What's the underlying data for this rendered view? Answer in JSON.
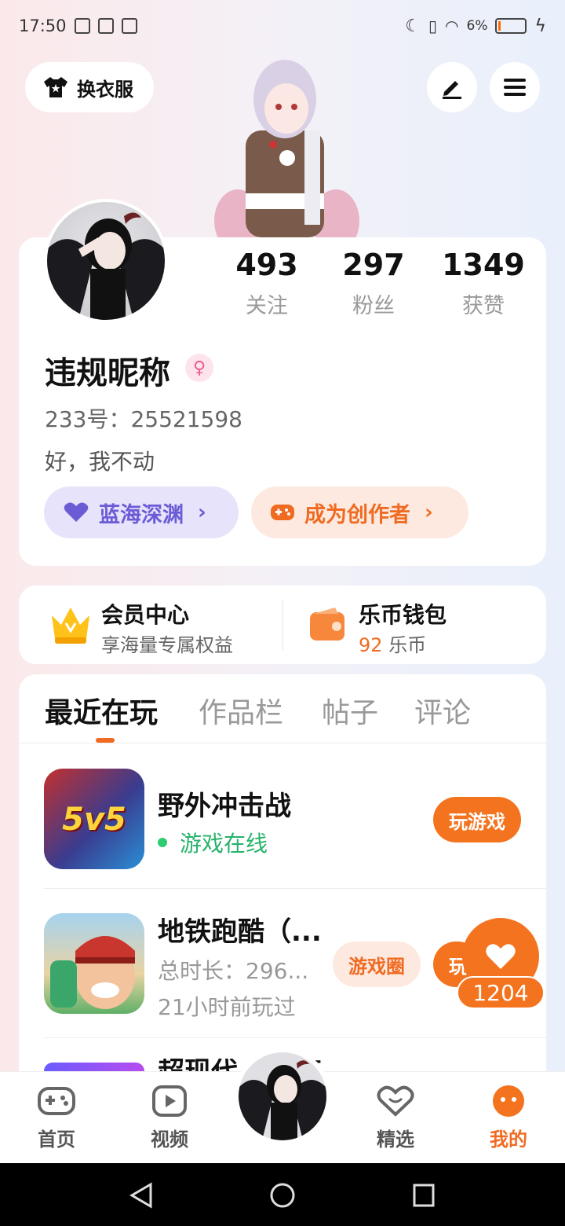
{
  "status_bar": {
    "time": "17:50",
    "battery": "6%"
  },
  "header": {
    "outfit_label": "换衣服"
  },
  "stats": [
    {
      "value": "493",
      "label": "关注"
    },
    {
      "value": "297",
      "label": "粉丝"
    },
    {
      "value": "1349",
      "label": "获赞"
    }
  ],
  "profile": {
    "nickname": "违规昵称",
    "gender_symbol": "♀",
    "uid": "233号：25521598",
    "bio": "好，我不动",
    "level_pill": "蓝海深渊",
    "creator_pill": "成为创作者"
  },
  "vip": {
    "member_title": "会员中心",
    "member_sub": "享海量专属权益",
    "wallet_title": "乐币钱包",
    "wallet_amount": "92",
    "wallet_unit": "乐币"
  },
  "tabs": [
    {
      "label": "最近在玩"
    },
    {
      "label": "作品栏"
    },
    {
      "label": "帖子"
    },
    {
      "label": "评论"
    }
  ],
  "games": [
    {
      "title": "野外冲击战",
      "status": "游戏在线",
      "play_label": "玩游戏",
      "icon_text": "5v5"
    },
    {
      "title": "地铁跑酷（...",
      "duration": "总时长：296...",
      "last_played": "21小时前玩过",
      "circle_label": "游戏圈",
      "play_label": "玩"
    },
    {
      "title": "超现代...加速"
    }
  ],
  "like_count": "1204",
  "bottom_nav": {
    "home": "首页",
    "video": "视频",
    "featured": "精选",
    "mine": "我的"
  },
  "colors": {
    "accent": "#f4731e",
    "online": "#26b36b",
    "purple": "#6b5cd6"
  }
}
